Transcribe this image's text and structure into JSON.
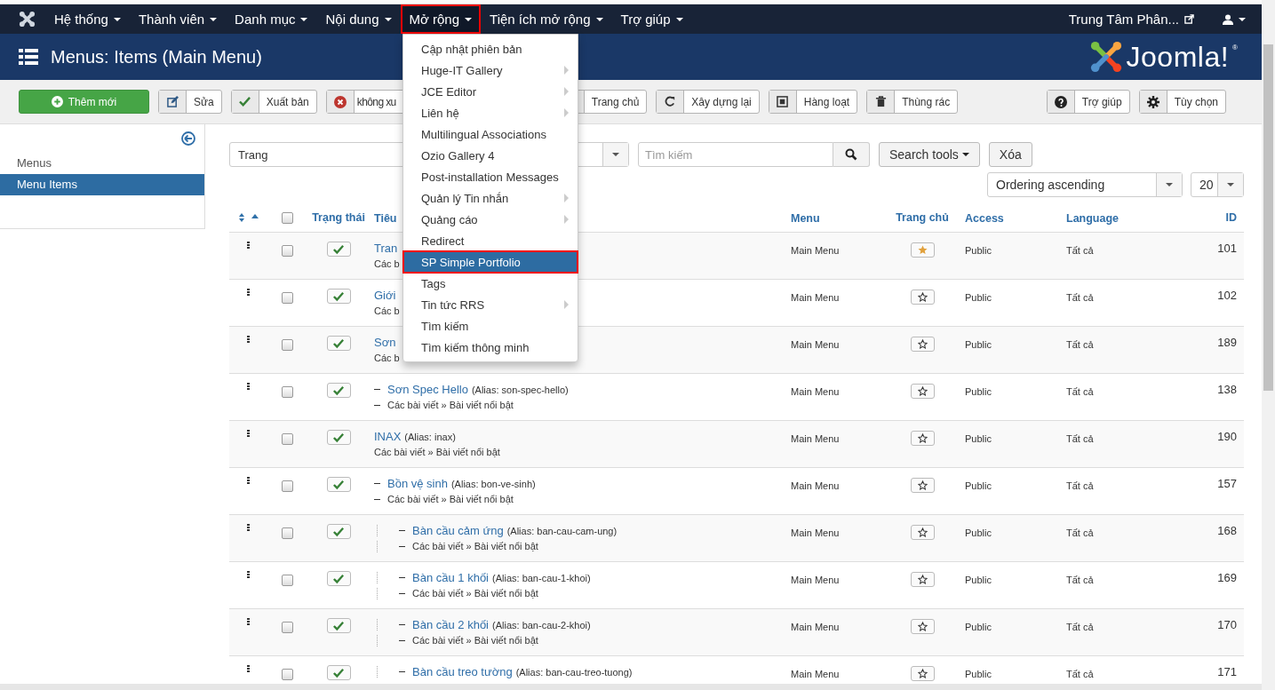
{
  "navbar": {
    "items": [
      {
        "label": "Hệ thống",
        "selected": false
      },
      {
        "label": "Thành viên",
        "selected": false
      },
      {
        "label": "Danh mục",
        "selected": false
      },
      {
        "label": "Nội dung",
        "selected": false
      },
      {
        "label": "Mở rộng",
        "selected": true
      },
      {
        "label": "Tiện ích mở rộng",
        "selected": false
      },
      {
        "label": "Trợ giúp",
        "selected": false
      }
    ],
    "site_link": "Trung Tâm Phân...",
    "dropdown": [
      {
        "label": "Cập nhật phiên bản",
        "submenu": false,
        "selected": false
      },
      {
        "label": "Huge-IT Gallery",
        "submenu": true,
        "selected": false
      },
      {
        "label": "JCE Editor",
        "submenu": true,
        "selected": false
      },
      {
        "label": "Liên hệ",
        "submenu": true,
        "selected": false
      },
      {
        "label": "Multilingual Associations",
        "submenu": false,
        "selected": false
      },
      {
        "label": "Ozio Gallery 4",
        "submenu": false,
        "selected": false
      },
      {
        "label": "Post-installation Messages",
        "submenu": false,
        "selected": false
      },
      {
        "label": "Quản lý Tin nhắn",
        "submenu": true,
        "selected": false
      },
      {
        "label": "Quảng cáo",
        "submenu": true,
        "selected": false
      },
      {
        "label": "Redirect",
        "submenu": false,
        "selected": false
      },
      {
        "label": "SP Simple Portfolio",
        "submenu": false,
        "selected": true
      },
      {
        "label": "Tags",
        "submenu": false,
        "selected": false
      },
      {
        "label": "Tin tức RRS",
        "submenu": true,
        "selected": false
      },
      {
        "label": "Tìm kiếm",
        "submenu": false,
        "selected": false
      },
      {
        "label": "Tìm kiếm thông minh",
        "submenu": false,
        "selected": false
      }
    ]
  },
  "header": {
    "title": "Menus: Items (Main Menu)",
    "logo": "Joomla!",
    "logo_mark": "®"
  },
  "toolbar": {
    "left": [
      {
        "kind": "new",
        "label": "Thêm mới"
      },
      {
        "kind": "edit",
        "label": "Sửa"
      },
      {
        "kind": "publish",
        "label": "Xuất bản"
      },
      {
        "kind": "unpublish",
        "label": "không xu"
      },
      {
        "kind": "home",
        "label": "Trang chủ"
      },
      {
        "kind": "rebuild",
        "label": "Xây dựng lại"
      },
      {
        "kind": "batch",
        "label": "Hàng loạt"
      },
      {
        "kind": "trash",
        "label": "Thùng rác"
      }
    ],
    "right": [
      {
        "kind": "help",
        "label": "Trợ giúp"
      },
      {
        "kind": "options",
        "label": "Tùy chọn"
      }
    ]
  },
  "sidebar": {
    "items": [
      {
        "label": "Menus",
        "selected": false
      },
      {
        "label": "Menu Items",
        "selected": true
      }
    ]
  },
  "filters": {
    "menu_select": "Trang",
    "search": {
      "placeholder": "Tìm kiếm"
    },
    "search_tools": "Search tools",
    "clear": "Xóa",
    "ordering": "Ordering ascending",
    "limit": "20"
  },
  "table": {
    "columns": {
      "status": "Trạng thái",
      "title": "Tiêu",
      "menu": "Menu",
      "home": "Trang chủ",
      "access": "Access",
      "language": "Language",
      "id": "ID"
    },
    "select_all_checked": false,
    "rows": [
      {
        "title": "Tran",
        "subtitle": "Các b",
        "checked": false,
        "published": true,
        "menu": "Main Menu",
        "home": true,
        "access": "Public",
        "language": "Tất cả",
        "id": "101"
      },
      {
        "title": "Giới",
        "subtitle": "Các b",
        "checked": false,
        "published": true,
        "menu": "Main Menu",
        "home": false,
        "access": "Public",
        "language": "Tất cả",
        "id": "102"
      },
      {
        "title": "Sơn",
        "subtitle": "Các b",
        "checked": false,
        "published": true,
        "menu": "Main Menu",
        "home": false,
        "access": "Public",
        "language": "Tất cả",
        "id": "189",
        "children": [
          {
            "title": "Sơn Spec Hello",
            "alias": "(Alias: son-spec-hello)",
            "subtitle": "Các bài viết » Bài viết nổi bật",
            "checked": false,
            "published": true,
            "menu": "Main Menu",
            "home": false,
            "access": "Public",
            "language": "Tất cả",
            "id": "138"
          }
        ]
      },
      {
        "title": "INAX",
        "alias": "(Alias: inax)",
        "subtitle": "Các bài viết » Bài viết nổi bật",
        "checked": false,
        "published": true,
        "menu": "Main Menu",
        "home": false,
        "access": "Public",
        "language": "Tất cả",
        "id": "190",
        "children": [
          {
            "title": "Bồn vệ sinh",
            "alias": "(Alias: bon-ve-sinh)",
            "subtitle": "Các bài viết » Bài viết nổi bật",
            "checked": false,
            "published": true,
            "menu": "Main Menu",
            "home": false,
            "access": "Public",
            "language": "Tất cả",
            "id": "157",
            "children": [
              {
                "title": "Bàn cầu cảm ứng",
                "alias": "(Alias: ban-cau-cam-ung)",
                "subtitle": "Các bài viết » Bài viết nổi bật",
                "checked": false,
                "published": true,
                "menu": "Main Menu",
                "home": false,
                "access": "Public",
                "language": "Tất cả",
                "id": "168"
              },
              {
                "title": "Bàn cầu 1 khối",
                "alias": "(Alias: ban-cau-1-khoi)",
                "subtitle": "Các bài viết » Bài viết nổi bật",
                "checked": false,
                "published": true,
                "menu": "Main Menu",
                "home": false,
                "access": "Public",
                "language": "Tất cả",
                "id": "169"
              },
              {
                "title": "Bàn cầu 2 khối",
                "alias": "(Alias: ban-cau-2-khoi)",
                "subtitle": "Các bài viết » Bài viết nổi bật",
                "checked": false,
                "published": true,
                "menu": "Main Menu",
                "home": false,
                "access": "Public",
                "language": "Tất cả",
                "id": "170"
              },
              {
                "title": "Bàn cầu treo tường",
                "alias": "(Alias: ban-cau-treo-tuong)",
                "checked": false,
                "published": true,
                "menu": "Main Menu",
                "home": false,
                "access": "Public",
                "language": "Tất cả",
                "id": "171"
              }
            ]
          }
        ]
      }
    ]
  }
}
